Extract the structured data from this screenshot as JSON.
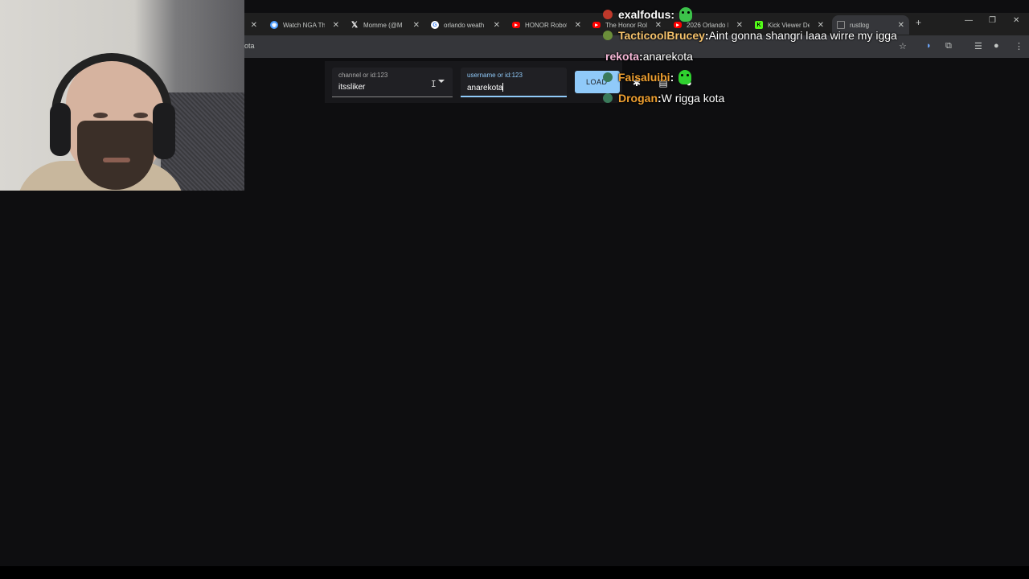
{
  "browser": {
    "tabs": [
      {
        "title": "",
        "icon": "blank-icon",
        "active": false
      },
      {
        "title": "Watch NGA Th",
        "icon": "stream-icon",
        "active": false
      },
      {
        "title": "Momme (@M",
        "icon": "x-logo-icon",
        "active": false
      },
      {
        "title": "orlando weath",
        "icon": "google-icon",
        "active": false
      },
      {
        "title": "HONOR Robot",
        "icon": "youtube-icon",
        "active": false
      },
      {
        "title": "The Honor Rol",
        "icon": "youtube-icon",
        "active": false
      },
      {
        "title": "2026 Orlando I",
        "icon": "youtube-icon",
        "active": false
      },
      {
        "title": "Kick Viewer De",
        "icon": "kick-icon",
        "active": false
      },
      {
        "title": "rustlog",
        "icon": "page-icon",
        "active": true
      }
    ],
    "new_tab_label": "+",
    "address_partial": "ota",
    "colors": {
      "tabstrip": "#1f1f1f",
      "toolbar": "#35363a"
    }
  },
  "form": {
    "channel_label": "channel or id:123",
    "channel_value": "itssliker",
    "username_label": "username or id:123",
    "username_value": "anarekota",
    "load_label": "LOAD",
    "accent": "#90caf9"
  },
  "chat": [
    {
      "user": "exalfodus",
      "sep": " : ",
      "text": "",
      "emote": "green-ghost-emote",
      "badge_color": "#c0392b",
      "user_color": "#ffffff"
    },
    {
      "user": "TacticoolBrucey",
      "sep": " : ",
      "text": "Aint gonna shangri laaa wirre my igga",
      "emote": "",
      "badge_color": "#6b8e3a",
      "user_color": "#f5c26b"
    },
    {
      "user": "rekota",
      "sep": " : ",
      "text": "anarekota",
      "emote": "",
      "badge_color": "",
      "user_color": "#f5b7d6"
    },
    {
      "user": "Faisaluibi",
      "sep": " : ",
      "text": "",
      "emote": "green-blob-emote",
      "badge_color": "#3a7a5a",
      "user_color": "#f0a030"
    },
    {
      "user": "Drogan",
      "sep": " : ",
      "text": "W rigga kota",
      "emote": "",
      "badge_color": "#3a7a5a",
      "user_color": "#f0a030"
    }
  ]
}
